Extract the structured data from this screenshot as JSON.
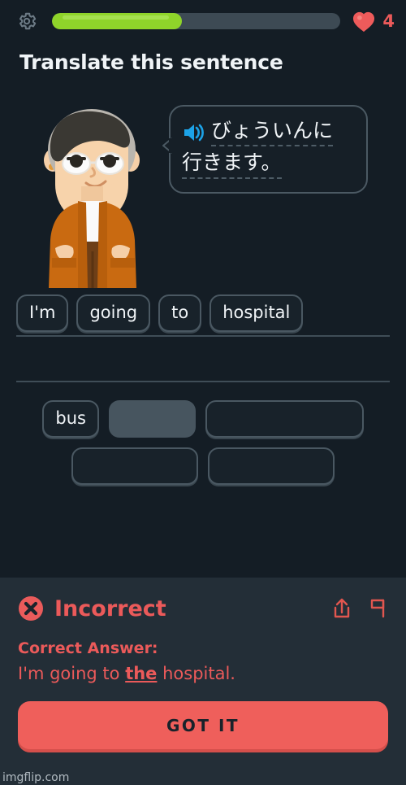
{
  "app": {
    "background_color": "#141d25",
    "accent_green": "#8fd42a",
    "accent_red": "#eb5a5a",
    "accent_blue": "#1cb0f6"
  },
  "topbar": {
    "settings_icon": "gear-icon",
    "progress_percent": 45,
    "hearts_icon": "heart-icon",
    "hearts_count": "4"
  },
  "exercise": {
    "title": "Translate this sentence",
    "character_icon": "duolingo-character-lucy",
    "speaker_icon": "speaker-icon",
    "prompt_lines": [
      "びょういんに",
      "行きます。"
    ]
  },
  "answer": {
    "row1_tiles": [
      "I'm",
      "going",
      "to",
      "hospital"
    ],
    "row2_tiles": []
  },
  "word_bank": {
    "tiles": [
      {
        "label": "bus",
        "used": false
      },
      {
        "label": "",
        "used": true
      },
      {
        "label": "",
        "used": false,
        "clipped": true
      },
      {
        "label": "",
        "used": false,
        "clipped": true
      },
      {
        "label": "",
        "used": false,
        "clipped": true
      }
    ]
  },
  "feedback": {
    "status_icon": "x-circle-icon",
    "status": "Incorrect",
    "share_icon": "share-icon",
    "report_icon": "flag-icon",
    "correct_label": "Correct Answer:",
    "correct_answer_prefix": "I'm going to ",
    "correct_answer_highlight": "the",
    "correct_answer_suffix": " hospital.",
    "cta_label": "GOT IT"
  },
  "watermark": {
    "text": "imgflip.com"
  }
}
